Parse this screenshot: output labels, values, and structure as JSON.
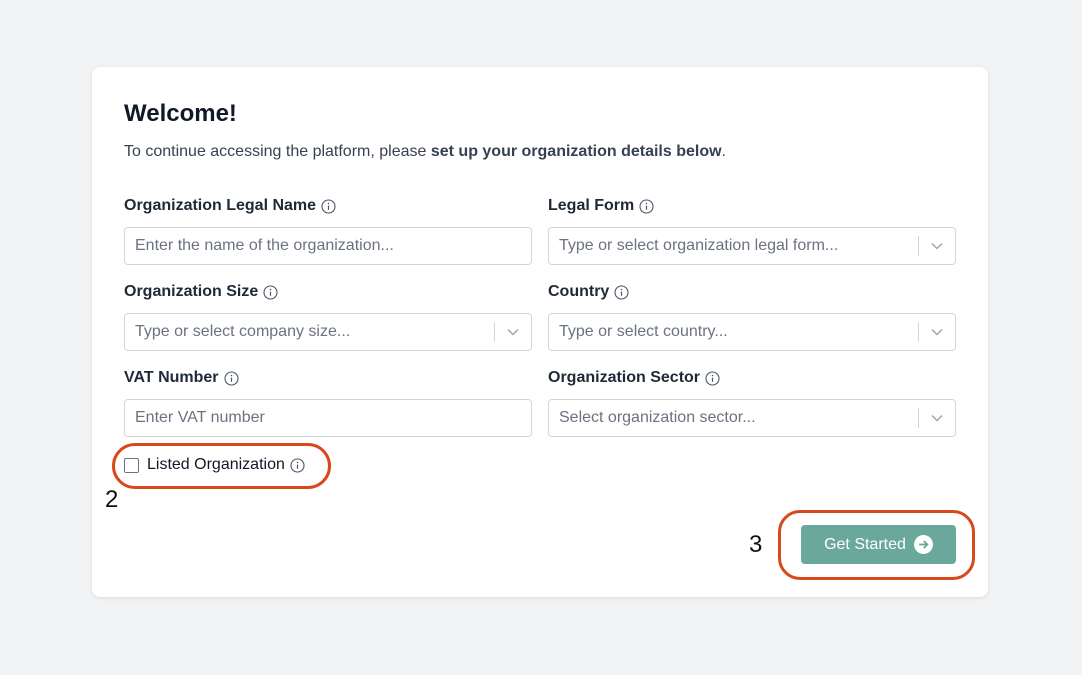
{
  "card": {
    "title": "Welcome!",
    "subtitle_prefix": "To continue accessing the platform, please ",
    "subtitle_bold": "set up your organization details below",
    "subtitle_suffix": "."
  },
  "form": {
    "legal_name": {
      "label": "Organization Legal Name",
      "placeholder": "Enter the name of the organization..."
    },
    "legal_form": {
      "label": "Legal Form",
      "placeholder": "Type or select organization legal form..."
    },
    "size": {
      "label": "Organization Size",
      "placeholder": "Type or select company size..."
    },
    "country": {
      "label": "Country",
      "placeholder": "Type or select country..."
    },
    "vat": {
      "label": "VAT Number",
      "placeholder": "Enter VAT number"
    },
    "sector": {
      "label": "Organization Sector",
      "placeholder": "Select organization sector..."
    },
    "listed": {
      "label": "Listed Organization",
      "checked": false
    }
  },
  "actions": {
    "get_started_label": "Get Started"
  },
  "annotations": {
    "callout_2": "2",
    "callout_3": "3"
  },
  "icons": {
    "info": "info-circle-icon",
    "chevron": "chevron-down-icon",
    "arrow": "arrow-right-circle-icon"
  },
  "colors": {
    "background": "#f2f3f5",
    "primary_button": "#69a89a",
    "callout": "#d9481a"
  }
}
